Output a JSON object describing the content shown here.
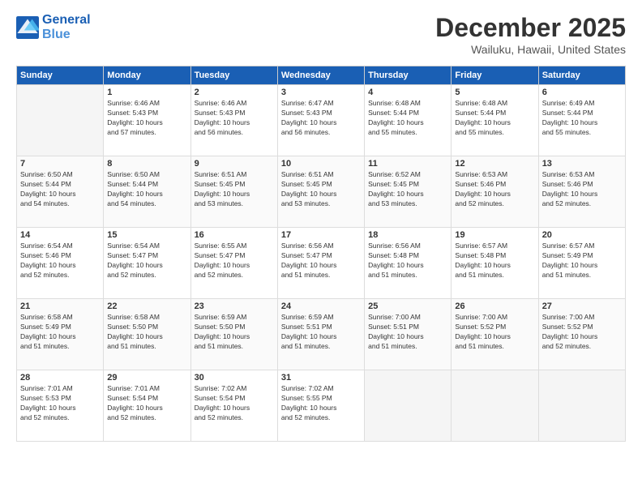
{
  "header": {
    "logo_line1": "General",
    "logo_line2": "Blue",
    "title": "December 2025",
    "location": "Wailuku, Hawaii, United States"
  },
  "weekdays": [
    "Sunday",
    "Monday",
    "Tuesday",
    "Wednesday",
    "Thursday",
    "Friday",
    "Saturday"
  ],
  "weeks": [
    [
      {
        "day": "",
        "info": ""
      },
      {
        "day": "1",
        "info": "Sunrise: 6:46 AM\nSunset: 5:43 PM\nDaylight: 10 hours\nand 57 minutes."
      },
      {
        "day": "2",
        "info": "Sunrise: 6:46 AM\nSunset: 5:43 PM\nDaylight: 10 hours\nand 56 minutes."
      },
      {
        "day": "3",
        "info": "Sunrise: 6:47 AM\nSunset: 5:43 PM\nDaylight: 10 hours\nand 56 minutes."
      },
      {
        "day": "4",
        "info": "Sunrise: 6:48 AM\nSunset: 5:44 PM\nDaylight: 10 hours\nand 55 minutes."
      },
      {
        "day": "5",
        "info": "Sunrise: 6:48 AM\nSunset: 5:44 PM\nDaylight: 10 hours\nand 55 minutes."
      },
      {
        "day": "6",
        "info": "Sunrise: 6:49 AM\nSunset: 5:44 PM\nDaylight: 10 hours\nand 55 minutes."
      }
    ],
    [
      {
        "day": "7",
        "info": "Sunrise: 6:50 AM\nSunset: 5:44 PM\nDaylight: 10 hours\nand 54 minutes."
      },
      {
        "day": "8",
        "info": "Sunrise: 6:50 AM\nSunset: 5:44 PM\nDaylight: 10 hours\nand 54 minutes."
      },
      {
        "day": "9",
        "info": "Sunrise: 6:51 AM\nSunset: 5:45 PM\nDaylight: 10 hours\nand 53 minutes."
      },
      {
        "day": "10",
        "info": "Sunrise: 6:51 AM\nSunset: 5:45 PM\nDaylight: 10 hours\nand 53 minutes."
      },
      {
        "day": "11",
        "info": "Sunrise: 6:52 AM\nSunset: 5:45 PM\nDaylight: 10 hours\nand 53 minutes."
      },
      {
        "day": "12",
        "info": "Sunrise: 6:53 AM\nSunset: 5:46 PM\nDaylight: 10 hours\nand 52 minutes."
      },
      {
        "day": "13",
        "info": "Sunrise: 6:53 AM\nSunset: 5:46 PM\nDaylight: 10 hours\nand 52 minutes."
      }
    ],
    [
      {
        "day": "14",
        "info": "Sunrise: 6:54 AM\nSunset: 5:46 PM\nDaylight: 10 hours\nand 52 minutes."
      },
      {
        "day": "15",
        "info": "Sunrise: 6:54 AM\nSunset: 5:47 PM\nDaylight: 10 hours\nand 52 minutes."
      },
      {
        "day": "16",
        "info": "Sunrise: 6:55 AM\nSunset: 5:47 PM\nDaylight: 10 hours\nand 52 minutes."
      },
      {
        "day": "17",
        "info": "Sunrise: 6:56 AM\nSunset: 5:47 PM\nDaylight: 10 hours\nand 51 minutes."
      },
      {
        "day": "18",
        "info": "Sunrise: 6:56 AM\nSunset: 5:48 PM\nDaylight: 10 hours\nand 51 minutes."
      },
      {
        "day": "19",
        "info": "Sunrise: 6:57 AM\nSunset: 5:48 PM\nDaylight: 10 hours\nand 51 minutes."
      },
      {
        "day": "20",
        "info": "Sunrise: 6:57 AM\nSunset: 5:49 PM\nDaylight: 10 hours\nand 51 minutes."
      }
    ],
    [
      {
        "day": "21",
        "info": "Sunrise: 6:58 AM\nSunset: 5:49 PM\nDaylight: 10 hours\nand 51 minutes."
      },
      {
        "day": "22",
        "info": "Sunrise: 6:58 AM\nSunset: 5:50 PM\nDaylight: 10 hours\nand 51 minutes."
      },
      {
        "day": "23",
        "info": "Sunrise: 6:59 AM\nSunset: 5:50 PM\nDaylight: 10 hours\nand 51 minutes."
      },
      {
        "day": "24",
        "info": "Sunrise: 6:59 AM\nSunset: 5:51 PM\nDaylight: 10 hours\nand 51 minutes."
      },
      {
        "day": "25",
        "info": "Sunrise: 7:00 AM\nSunset: 5:51 PM\nDaylight: 10 hours\nand 51 minutes."
      },
      {
        "day": "26",
        "info": "Sunrise: 7:00 AM\nSunset: 5:52 PM\nDaylight: 10 hours\nand 51 minutes."
      },
      {
        "day": "27",
        "info": "Sunrise: 7:00 AM\nSunset: 5:52 PM\nDaylight: 10 hours\nand 52 minutes."
      }
    ],
    [
      {
        "day": "28",
        "info": "Sunrise: 7:01 AM\nSunset: 5:53 PM\nDaylight: 10 hours\nand 52 minutes."
      },
      {
        "day": "29",
        "info": "Sunrise: 7:01 AM\nSunset: 5:54 PM\nDaylight: 10 hours\nand 52 minutes."
      },
      {
        "day": "30",
        "info": "Sunrise: 7:02 AM\nSunset: 5:54 PM\nDaylight: 10 hours\nand 52 minutes."
      },
      {
        "day": "31",
        "info": "Sunrise: 7:02 AM\nSunset: 5:55 PM\nDaylight: 10 hours\nand 52 minutes."
      },
      {
        "day": "",
        "info": ""
      },
      {
        "day": "",
        "info": ""
      },
      {
        "day": "",
        "info": ""
      }
    ]
  ]
}
